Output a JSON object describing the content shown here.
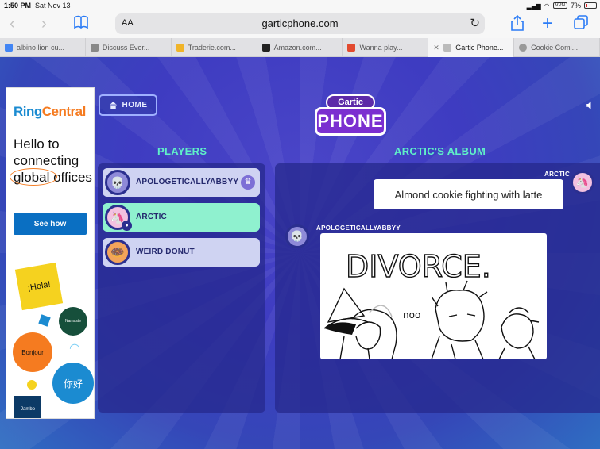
{
  "status": {
    "time": "1:50 PM",
    "date": "Sat Nov 13",
    "vpn": "VPN",
    "battery": "7%"
  },
  "browser": {
    "text_size_label": "AA",
    "url": "garticphone.com",
    "tabs": [
      {
        "label": "albino lion cu...",
        "favicon_color": "#4285f4"
      },
      {
        "label": "Discuss Ever...",
        "favicon_color": "#888888"
      },
      {
        "label": "Traderie.com...",
        "favicon_color": "#f0b429"
      },
      {
        "label": "Amazon.com...",
        "favicon_color": "#222222"
      },
      {
        "label": "Wanna play...",
        "favicon_color": "#e24a2f"
      },
      {
        "label": "Gartic Phone...",
        "favicon_color": "#bbbbbb",
        "active": true
      },
      {
        "label": "Cookie Comi...",
        "favicon_color": "#999999"
      }
    ]
  },
  "ad": {
    "brand_part1": "Ring",
    "brand_part2": "Central",
    "tagline": "Hello to connecting global offices",
    "cta": "See how",
    "hola": "¡Hola!",
    "namaste": "Namaste",
    "bonjour": "Bonjour",
    "nihao": "你好",
    "jambo": "Jambo"
  },
  "game": {
    "home_label": "HOME",
    "logo_top": "Gartic",
    "logo_main": "PHONE",
    "players_title": "PLAYERS",
    "album_title": "ARCTIC'S ALBUM",
    "players": [
      {
        "name": "APOLOGETICALLYABBYY",
        "host": true
      },
      {
        "name": "ARCTIC",
        "active": true
      },
      {
        "name": "WEIRD DONUT"
      }
    ],
    "album": {
      "prompt_author": "ARCTIC",
      "prompt_text": "Almond cookie fighting with latte",
      "drawing_author": "APOLOGETICALLYABBYY",
      "drawing_text": "DIVORCE.",
      "drawing_small_text": "noo"
    }
  },
  "colors": {
    "accent_green": "#5ff0c8",
    "active_player": "#8ff1cf",
    "panel": "#26288c"
  }
}
